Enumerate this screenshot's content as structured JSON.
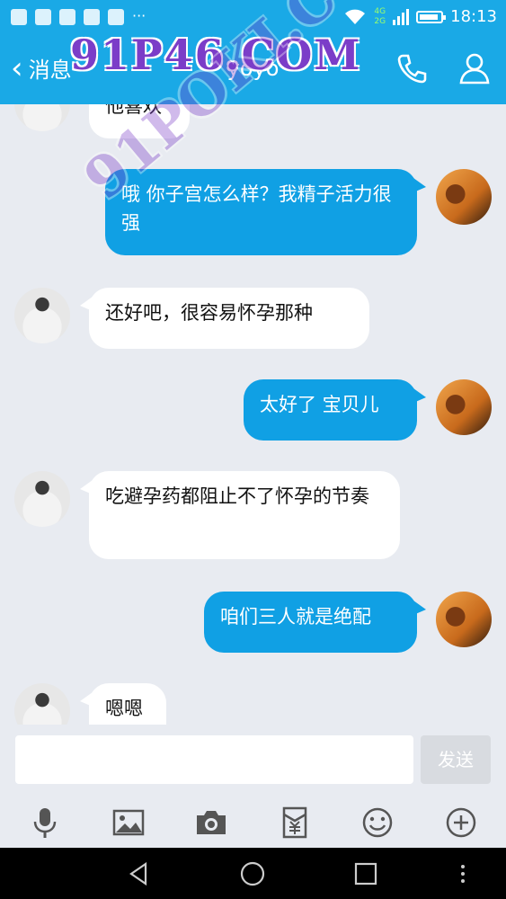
{
  "status_bar": {
    "time": "18:13",
    "network_4g": "4G",
    "network_2g": "2G",
    "more": "···"
  },
  "header": {
    "back_label": "消息",
    "title": "yoyo",
    "icons": [
      "phone-icon",
      "user-icon"
    ]
  },
  "watermarks": {
    "main": "91P46.COM",
    "diagonal": "91POKI.COM"
  },
  "messages": [
    {
      "side": "left",
      "text": "他喜欢"
    },
    {
      "side": "right",
      "text": "哦 你子宫怎么样？我精子活力很强"
    },
    {
      "side": "left",
      "text": "还好吧，很容易怀孕那种"
    },
    {
      "side": "right",
      "text": "太好了 宝贝儿"
    },
    {
      "side": "left",
      "text": "吃避孕药都阻止不了怀孕的节奏"
    },
    {
      "side": "right",
      "text": "咱们三人就是绝配"
    },
    {
      "side": "left",
      "text": "嗯嗯"
    }
  ],
  "input": {
    "value": "",
    "send_label": "发送"
  },
  "toolbar_icons": [
    "microphone-icon",
    "image-icon",
    "camera-icon",
    "red-packet-icon",
    "emoji-icon",
    "plus-icon"
  ],
  "nav_icons": [
    "back-triangle-icon",
    "home-circle-icon",
    "recent-square-icon",
    "menu-dots-icon"
  ],
  "colors": {
    "accent": "#1aa9e6",
    "bubble_right": "#10a0e4",
    "bubble_left": "#ffffff",
    "background": "#e8ebf1"
  }
}
